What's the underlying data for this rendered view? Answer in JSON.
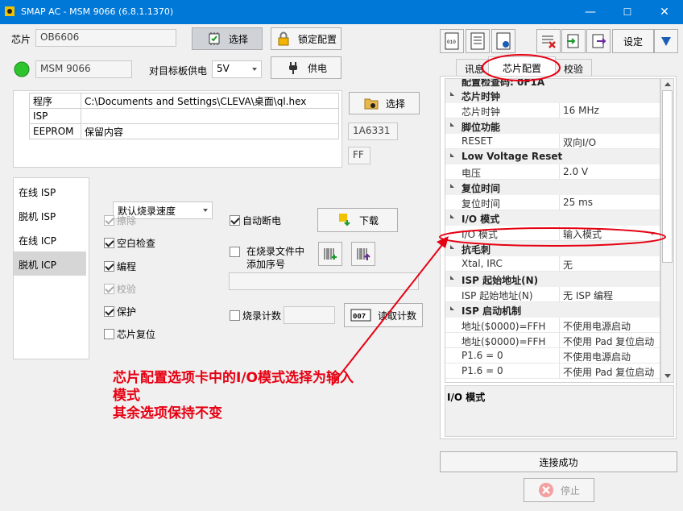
{
  "window": {
    "title": "SMAP AC - MSM 9066  (6.8.1.1370)",
    "minimize": "—",
    "maximize": "☐",
    "close": "✕"
  },
  "chip": {
    "label": "芯片",
    "value": "OB6606",
    "select_btn": "选择",
    "lock_btn": "锁定配置",
    "model": "MSM 9066",
    "power_label": "对目标板供电",
    "power_value": "5V",
    "power_btn": "供电"
  },
  "files": {
    "rows": [
      {
        "name": "程序",
        "path": "C:\\Documents and Settings\\CLEVA\\桌面\\ql.hex"
      },
      {
        "name": "ISP",
        "path": ""
      },
      {
        "name": "EEPROM",
        "path": "保留内容"
      }
    ],
    "select_btn": "选择",
    "checksum": "1A6331",
    "eeprom_code": "FF"
  },
  "modes": {
    "items": [
      "在线 ISP",
      "脱机 ISP",
      "在线 ICP",
      "脱机 ICP"
    ],
    "selected": "脱机 ICP"
  },
  "options": {
    "speed": "默认烧录速度",
    "checks": [
      {
        "label": "擦除",
        "checked": true,
        "disabled": true
      },
      {
        "label": "空白检查",
        "checked": true,
        "disabled": false
      },
      {
        "label": "编程",
        "checked": true,
        "disabled": false
      },
      {
        "label": "校验",
        "checked": true,
        "disabled": true
      },
      {
        "label": "保护",
        "checked": true,
        "disabled": false
      },
      {
        "label": "芯片复位",
        "checked": false,
        "disabled": false
      }
    ],
    "auto_power_off": "自动断电",
    "download_btn": "下载",
    "add_serial": "在烧录文件中添加序号",
    "burn_count": "烧录计数",
    "read_count_btn": "读取计数"
  },
  "toolbar": {
    "settings_btn": "设定"
  },
  "tabs": {
    "items": [
      "讯息",
      "芯片配置",
      "校验"
    ],
    "active": "芯片配置"
  },
  "props": {
    "top_partial": "配置检查码: 0F1A",
    "groups": [
      {
        "cat": "芯片时钟",
        "rows": [
          {
            "k": "芯片时钟",
            "v": "16 MHz"
          }
        ]
      },
      {
        "cat": "脚位功能",
        "rows": [
          {
            "k": "RESET",
            "v": "双向I/O"
          }
        ]
      },
      {
        "cat": "Low Voltage Reset",
        "rows": [
          {
            "k": "电压",
            "v": "2.0 V"
          }
        ]
      },
      {
        "cat": "复位时间",
        "rows": [
          {
            "k": "复位时间",
            "v": "25 ms"
          }
        ]
      },
      {
        "cat": "I/O 模式",
        "rows": [
          {
            "k": "I/O 模式",
            "v": "输入模式"
          }
        ]
      },
      {
        "cat": "抗毛刺",
        "rows": [
          {
            "k": "Xtal, IRC",
            "v": "无"
          }
        ]
      },
      {
        "cat": "ISP 起始地址(N)",
        "rows": [
          {
            "k": "ISP 起始地址(N)",
            "v": "无 ISP 编程"
          }
        ]
      },
      {
        "cat": "ISP 启动机制",
        "rows": [
          {
            "k": "地址($0000)=FFH",
            "v": "不使用电源启动"
          },
          {
            "k": "地址($0000)=FFH",
            "v": "不使用 Pad 复位启动"
          },
          {
            "k": "P1.6 = 0",
            "v": "不使用电源启动"
          },
          {
            "k": "P1.6 = 0",
            "v": "不使用 Pad 复位启动"
          }
        ]
      }
    ],
    "description_title": "I/O 模式"
  },
  "status": {
    "text": "连接成功",
    "stop_btn": "停止"
  },
  "annotation": {
    "line1": "芯片配置选项卡中的I/O模式选择为输入",
    "line2": "模式",
    "line3": "其余选项保持不变",
    "color": "#e60012"
  }
}
